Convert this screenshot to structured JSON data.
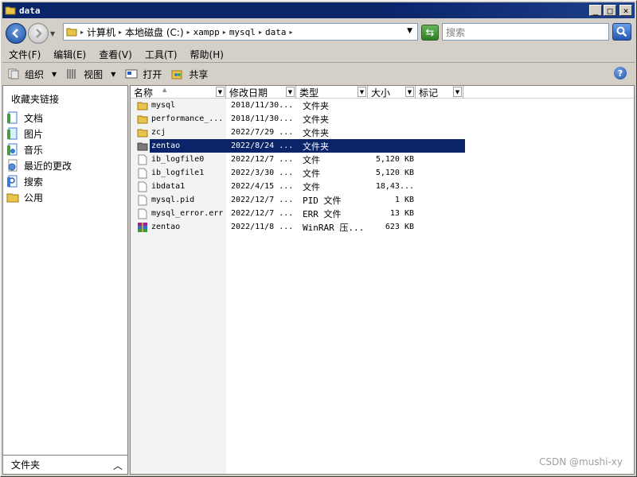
{
  "window": {
    "title": "data"
  },
  "address": {
    "crumbs": [
      "计算机",
      "本地磁盘 (C:)",
      "xampp",
      "mysql",
      "data"
    ],
    "search_placeholder": "搜索"
  },
  "menu": [
    "文件(F)",
    "编辑(E)",
    "查看(V)",
    "工具(T)",
    "帮助(H)"
  ],
  "toolbar": {
    "organize": "组织",
    "views": "视图",
    "open": "打开",
    "share": "共享"
  },
  "nav": {
    "heading": "收藏夹链接",
    "links": [
      {
        "label": "文档",
        "icon": "documents-icon"
      },
      {
        "label": "图片",
        "icon": "pictures-icon"
      },
      {
        "label": "音乐",
        "icon": "music-icon"
      },
      {
        "label": "最近的更改",
        "icon": "recent-changes-icon"
      },
      {
        "label": "搜索",
        "icon": "searches-icon"
      },
      {
        "label": "公用",
        "icon": "public-folder-icon"
      }
    ],
    "folders_label": "文件夹"
  },
  "columns": [
    "名称",
    "修改日期",
    "类型",
    "大小",
    "标记"
  ],
  "files": [
    {
      "name": "mysql",
      "date": "2018/11/30...",
      "type": "文件夹",
      "size": "",
      "icon": "folder-icon"
    },
    {
      "name": "performance_...",
      "date": "2018/11/30...",
      "type": "文件夹",
      "size": "",
      "icon": "folder-icon"
    },
    {
      "name": "zcj",
      "date": "2022/7/29 ...",
      "type": "文件夹",
      "size": "",
      "icon": "folder-icon"
    },
    {
      "name": "zentao",
      "date": "2022/8/24 ...",
      "type": "文件夹",
      "size": "",
      "icon": "folder-icon",
      "selected": true
    },
    {
      "name": "ib_logfile0",
      "date": "2022/12/7 ...",
      "type": "文件",
      "size": "5,120 KB",
      "icon": "file-icon"
    },
    {
      "name": "ib_logfile1",
      "date": "2022/3/30 ...",
      "type": "文件",
      "size": "5,120 KB",
      "icon": "file-icon"
    },
    {
      "name": "ibdata1",
      "date": "2022/4/15 ...",
      "type": "文件",
      "size": "18,43...",
      "icon": "file-icon"
    },
    {
      "name": "mysql.pid",
      "date": "2022/12/7 ...",
      "type": "PID 文件",
      "size": "1 KB",
      "icon": "file-icon"
    },
    {
      "name": "mysql_error.err",
      "date": "2022/12/7 ...",
      "type": "ERR 文件",
      "size": "13 KB",
      "icon": "file-icon"
    },
    {
      "name": "zentao",
      "date": "2022/11/8 ...",
      "type": "WinRAR 压...",
      "size": "623 KB",
      "icon": "winrar-archive-icon"
    }
  ],
  "watermark": "CSDN @mushi-xy",
  "colors": {
    "titlebar": "#0a246a",
    "selection": "#0a246a",
    "chrome": "#d4d0c8"
  }
}
